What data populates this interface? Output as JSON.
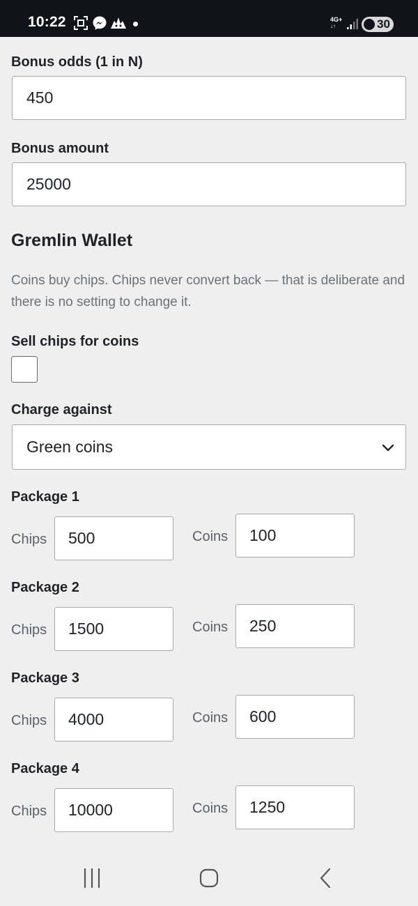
{
  "status_bar": {
    "time": "10:22",
    "icons": [
      "screenshot-icon",
      "messenger-icon",
      "game-icon"
    ],
    "network": "4G+",
    "battery": "30",
    "colors": {
      "background": "#12131a",
      "foreground": "#ffffff"
    }
  },
  "form": {
    "bonus_odds": {
      "label": "Bonus odds (1 in N)",
      "value": "450"
    },
    "bonus_amount": {
      "label": "Bonus amount",
      "value": "25000"
    }
  },
  "wallet": {
    "title": "Gremlin Wallet",
    "help": "Coins buy chips. Chips never convert back — that is deliberate and there is no setting to change it.",
    "sell_chips": {
      "label": "Sell chips for coins",
      "checked": false
    },
    "charge_against": {
      "label": "Charge against",
      "selected": "Green coins"
    },
    "chips_label": "Chips",
    "coins_label": "Coins",
    "packages": [
      {
        "label": "Package 1",
        "chips": "500",
        "coins": "100"
      },
      {
        "label": "Package 2",
        "chips": "1500",
        "coins": "250"
      },
      {
        "label": "Package 3",
        "chips": "4000",
        "coins": "600"
      },
      {
        "label": "Package 4",
        "chips": "10000",
        "coins": "1250"
      }
    ]
  },
  "nav_bar": {
    "buttons": [
      "recent-apps-icon",
      "home-icon",
      "back-icon"
    ]
  },
  "colors": {
    "page_background": "#efefef",
    "text": "#1f2328",
    "muted_text": "#6a7178",
    "input_border": "#a9a9a9"
  }
}
